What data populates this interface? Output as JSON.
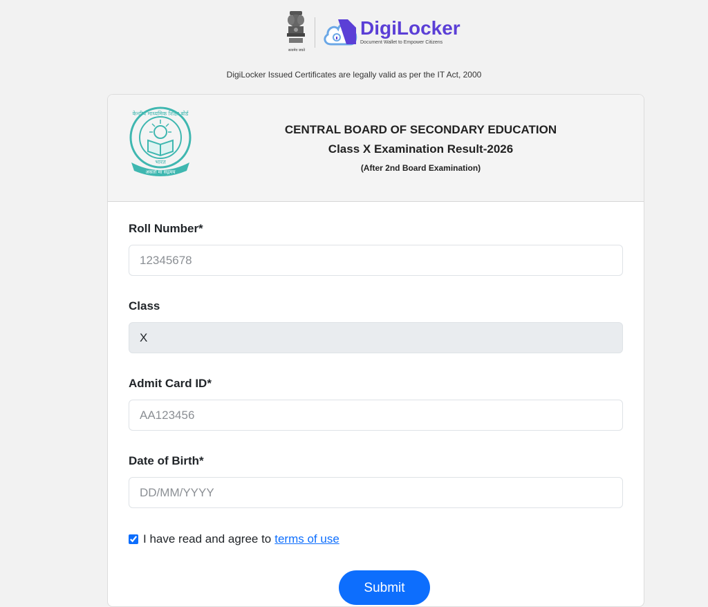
{
  "branding": {
    "emblem_caption": "सत्यमेव जयते",
    "app_name": "DigiLocker",
    "tagline": "Document Wallet to Empower Citizens",
    "brand_color": "#5b3fd6"
  },
  "legal_note": "DigiLocker Issued Certificates are legally valid as per the IT Act, 2000",
  "header": {
    "logo_top_text": "केन्द्रीय माध्यमिक शिक्षा बोर्ड",
    "logo_mid_text": "भारत",
    "logo_bottom_text": "असतो मा सद्गमय",
    "board": "CENTRAL BOARD OF SECONDARY EDUCATION",
    "exam": "Class X Examination Result-2026",
    "subtitle": "(After 2nd Board Examination)",
    "logo_color": "#3fb7b0"
  },
  "form": {
    "roll_number": {
      "label": "Roll Number*",
      "value": "",
      "placeholder": "12345678"
    },
    "class": {
      "label": "Class",
      "value": "X",
      "disabled": true
    },
    "admit_card": {
      "label": "Admit Card ID*",
      "value": "",
      "placeholder": "AA123456"
    },
    "dob": {
      "label": "Date of Birth*",
      "value": "",
      "placeholder": "DD/MM/YYYY"
    },
    "agree": {
      "checked": true,
      "text": "I have read and agree to",
      "link_text": "terms of use"
    },
    "submit_label": "Submit",
    "accent_color": "#0d6efd"
  }
}
